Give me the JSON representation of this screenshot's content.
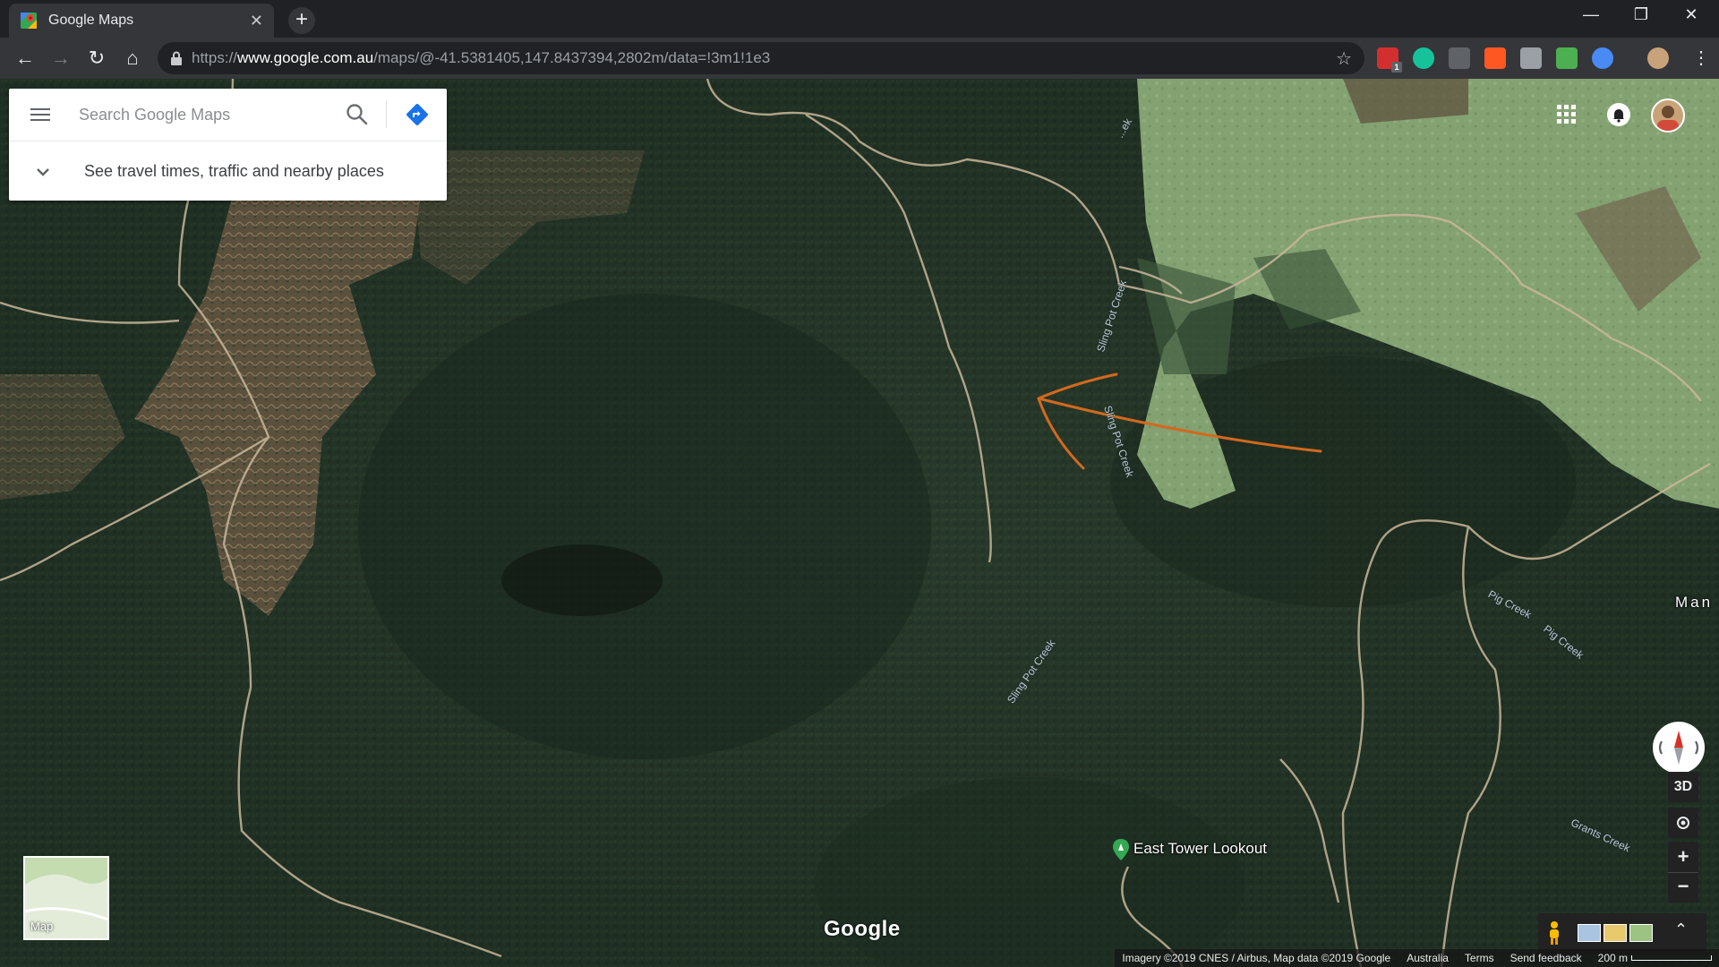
{
  "browser": {
    "tab_title": "Google Maps",
    "url_prefix": "https://",
    "url_host": "www.google.com.au",
    "url_path": "/maps/@-41.5381405,147.8437394,2802m/data=!3m1!1e3",
    "extensions": [
      {
        "icon": "adblock-icon",
        "badge": "1",
        "color": "#d32f2f"
      },
      {
        "icon": "grammarly-icon",
        "color": "#15c39a"
      },
      {
        "icon": "glasses-icon",
        "color": "#5f6368"
      },
      {
        "icon": "reddit-icon",
        "color": "#ff5722"
      },
      {
        "icon": "chat-icon",
        "color": "#9aa0a6"
      },
      {
        "icon": "leaf-icon",
        "color": "#4caf50"
      },
      {
        "icon": "globe-icon",
        "color": "#4a8af4"
      }
    ]
  },
  "search": {
    "placeholder": "Search Google Maps",
    "travel_prompt": "See travel times, traffic and nearby places"
  },
  "map": {
    "creek_labels": [
      "Sling Pot Creek",
      "Sling Pot Creek",
      "Sling Pot Creek",
      "Pig Creek",
      "Pig Creek",
      "Grants Creek",
      "...ek"
    ],
    "place_partial": "Man",
    "poi": "East Tower Lookout",
    "layer_label": "Map",
    "logo": "Google",
    "view_3d": "3D",
    "zoom_in": "+",
    "zoom_out": "−",
    "attribution": {
      "imagery": "Imagery ©2019 CNES / Airbus, Map data ©2019 Google",
      "region": "Australia",
      "terms": "Terms",
      "feedback": "Send feedback",
      "scale": "200 m"
    }
  },
  "colors": {
    "annotation_arrow": "#d2691e",
    "forest": "#1f3324",
    "pasture": "#8fae7a",
    "road": "#c9b79a"
  }
}
